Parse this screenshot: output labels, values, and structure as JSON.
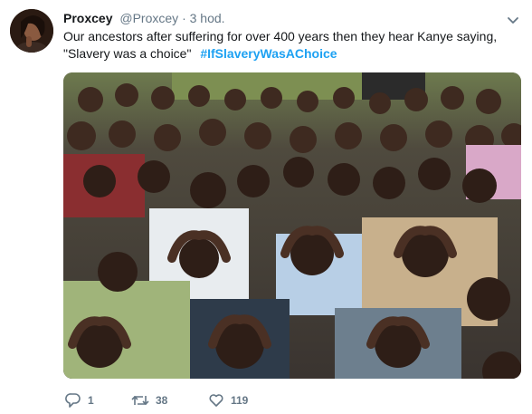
{
  "tweet": {
    "display_name": "Proxcey",
    "handle": "@Proxcey",
    "separator": "·",
    "time": "3 hod.",
    "text_line1": "Our ancestors after suffering for over 400 years then they hear Kanye saying,",
    "text_line2": "\"Slavery was a choice\"",
    "hashtag": "#IfSlaveryWasAChoice",
    "media_alt": "",
    "actions": {
      "reply_count": "1",
      "retweet_count": "38",
      "like_count": "119"
    }
  },
  "colors": {
    "link": "#1da1f2",
    "muted": "#657786",
    "text": "#14171a"
  },
  "icons": {
    "reply": "reply-icon",
    "retweet": "retweet-icon",
    "like": "heart-icon",
    "caret": "chevron-down-icon"
  }
}
